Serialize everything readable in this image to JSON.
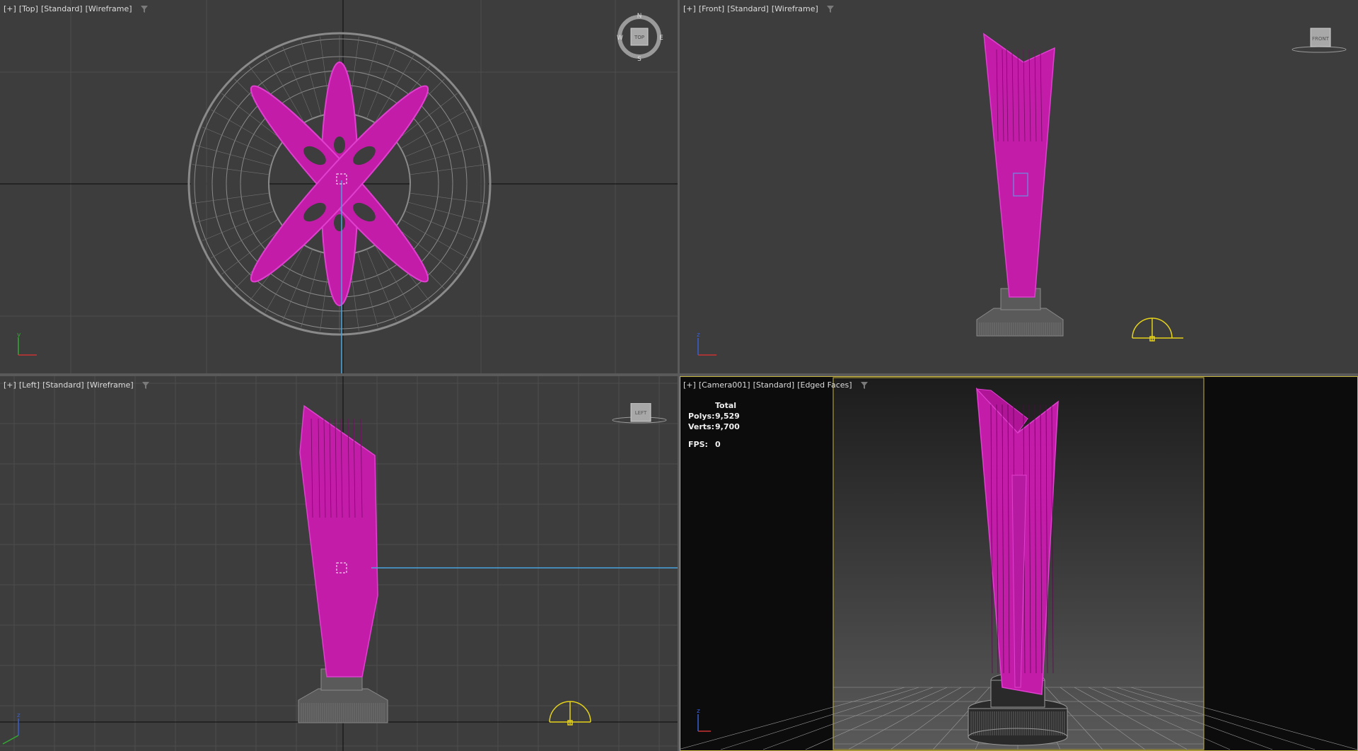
{
  "viewports": {
    "top": {
      "label": [
        "[+]",
        "[Top]",
        "[Standard]",
        "[Wireframe]"
      ],
      "compass": {
        "n": "N",
        "s": "S",
        "e": "E",
        "w": "W",
        "cube": "TOP"
      }
    },
    "front": {
      "label": [
        "[+]",
        "[Front]",
        "[Standard]",
        "[Wireframe]"
      ],
      "cube": "FRONT"
    },
    "left": {
      "label": [
        "[+]",
        "[Left]",
        "[Standard]",
        "[Wireframe]"
      ],
      "cube": "LEFT"
    },
    "camera": {
      "label": [
        "[+]",
        "[Camera001]",
        "[Standard]",
        "[Edged Faces]"
      ],
      "stats": {
        "header": "Total",
        "polys_label": "Polys:",
        "polys": "9,529",
        "verts_label": "Verts:",
        "verts": "9,700",
        "fps_label": "FPS:",
        "fps": "0"
      }
    }
  },
  "colors": {
    "object": "#c21ca8",
    "object_edge": "#e040d0",
    "pedestal": "#8a8a8a",
    "grid": "#4d4d4d",
    "axis": "#0a0a0a",
    "active_border": "#c9b642",
    "light": "#e5d21a"
  },
  "icons": [
    "filter-icon",
    "view-cube-icon",
    "compass-icon",
    "axis-tripod-icon",
    "light-icon",
    "pivot-icon"
  ]
}
